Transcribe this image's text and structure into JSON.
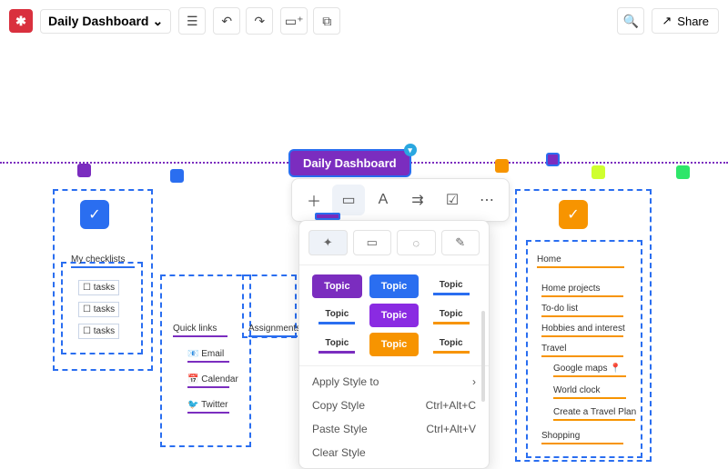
{
  "header": {
    "doc_title": "Daily Dashboard",
    "share": "Share"
  },
  "main_node": {
    "title": "Daily Dashboard"
  },
  "left": {
    "check": "✓",
    "my_checklists": "My checklists",
    "tasks1": "tasks",
    "tasks2": "tasks",
    "tasks3": "tasks",
    "quick_links": "Quick links",
    "email": "Email",
    "calendar": "Calendar",
    "twitter": "Twitter",
    "assignments": "Assignments"
  },
  "right": {
    "check": "✓",
    "home": "Home",
    "home_projects": "Home projects",
    "todo": "To-do list",
    "hobbies": "Hobbies and interest",
    "travel": "Travel",
    "maps": "Google maps",
    "world_clock": "World clock",
    "create_plan": "Create a Travel  Plan",
    "shopping": "Shopping"
  },
  "style": {
    "topic": "Topic",
    "apply": "Apply Style to",
    "copy": "Copy Style",
    "copy_k": "Ctrl+Alt+C",
    "paste": "Paste Style",
    "paste_k": "Ctrl+Alt+V",
    "clear": "Clear Style"
  },
  "chart_data": {
    "type": "diagram",
    "title": "Daily Dashboard",
    "root": "Daily Dashboard",
    "branches": [
      {
        "name": "My checklists",
        "children": [
          "tasks",
          "tasks",
          "tasks"
        ]
      },
      {
        "name": "Quick links",
        "children": [
          "Email",
          "Calendar",
          "Twitter"
        ]
      },
      {
        "name": "Assignments",
        "children": []
      },
      {
        "name": "Home",
        "children": [
          "Home projects",
          "To-do list",
          "Hobbies and interest",
          "Travel",
          "Google maps",
          "World clock",
          "Create a Travel Plan",
          "Shopping"
        ]
      }
    ]
  }
}
